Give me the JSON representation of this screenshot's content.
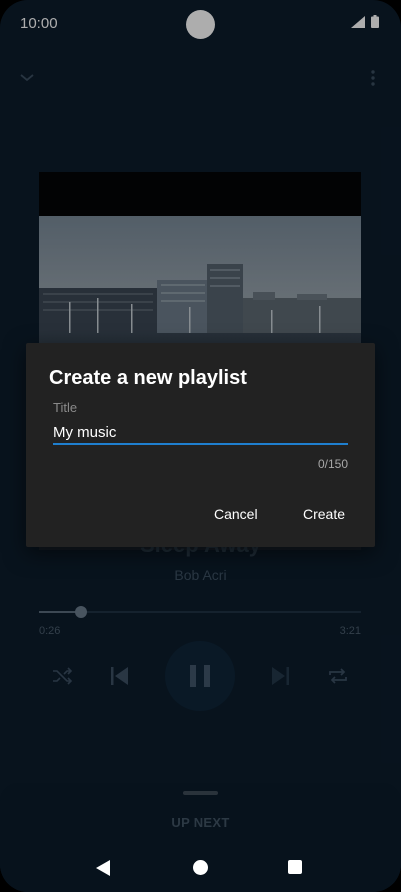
{
  "status_bar": {
    "time": "10:00",
    "signal_icon": "signal-icon",
    "battery_icon": "battery-icon"
  },
  "player": {
    "collapse_icon": "chevron-down-icon",
    "more_icon": "more-vertical-icon",
    "song_title": "Sleep Away",
    "artist": "Bob Acri",
    "progress": {
      "elapsed": "0:26",
      "total": "3:21",
      "fraction": 0.129
    },
    "controls": [
      "shuffle-icon",
      "previous-icon",
      "pause-icon",
      "next-icon",
      "repeat-icon"
    ]
  },
  "up_next": {
    "label": "UP NEXT"
  },
  "dialog": {
    "title": "Create a new playlist",
    "field_label": "Title",
    "field_value": "My music",
    "counter": "0/150",
    "cancel_label": "Cancel",
    "create_label": "Create",
    "accent_color": "#1f7fcf"
  },
  "nav_bar": {
    "back_icon": "back-triangle-icon",
    "home_icon": "home-circle-icon",
    "recents_icon": "recents-square-icon"
  }
}
